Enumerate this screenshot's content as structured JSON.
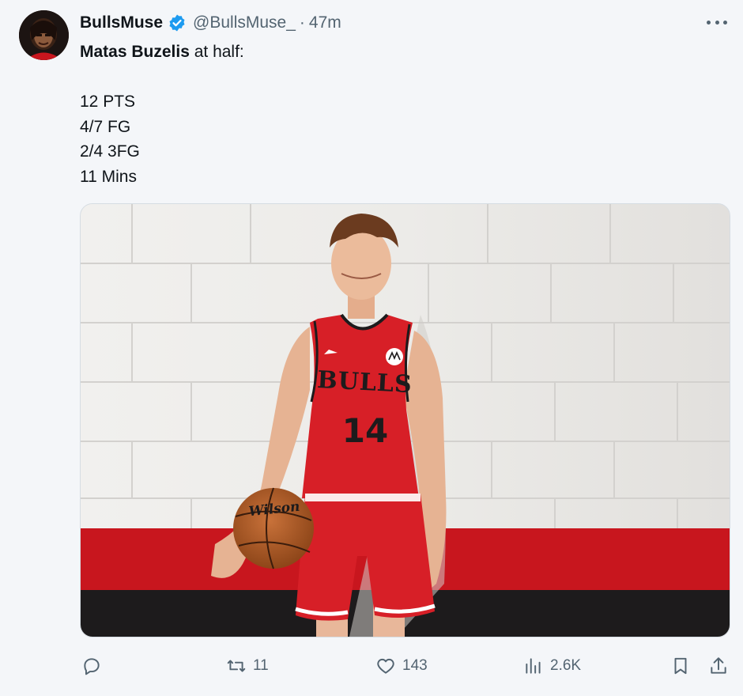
{
  "author": {
    "display_name": "BullsMuse",
    "handle": "@BullsMuse_",
    "separator": "·",
    "time": "47m",
    "verified": true,
    "avatar_icon": "avatar-illustration"
  },
  "tweet": {
    "mention": "Matas Buzelis",
    "headline_rest": " at half:",
    "stats": [
      "12 PTS",
      "4/7 FG",
      "2/4 3FG",
      "11 Mins"
    ]
  },
  "media": {
    "description_icon": "player-photo",
    "jersey_team": "BULLS",
    "jersey_number": "14",
    "ball_brand": "Wilson",
    "colors": {
      "jersey_red": "#d71f27",
      "wall": "#ecebe9",
      "stripe": "#c8161e"
    }
  },
  "actions": {
    "reply": {
      "icon": "reply-icon",
      "count": ""
    },
    "retweet": {
      "icon": "retweet-icon",
      "count": "11"
    },
    "like": {
      "icon": "heart-icon",
      "count": "143"
    },
    "views": {
      "icon": "views-icon",
      "count": "2.6K"
    },
    "bookmark": {
      "icon": "bookmark-icon"
    },
    "share": {
      "icon": "share-icon"
    }
  },
  "colors": {
    "accent": "#1d9bf0",
    "text_primary": "#0f1419",
    "text_secondary": "#536471",
    "background": "#f4f6f9"
  }
}
